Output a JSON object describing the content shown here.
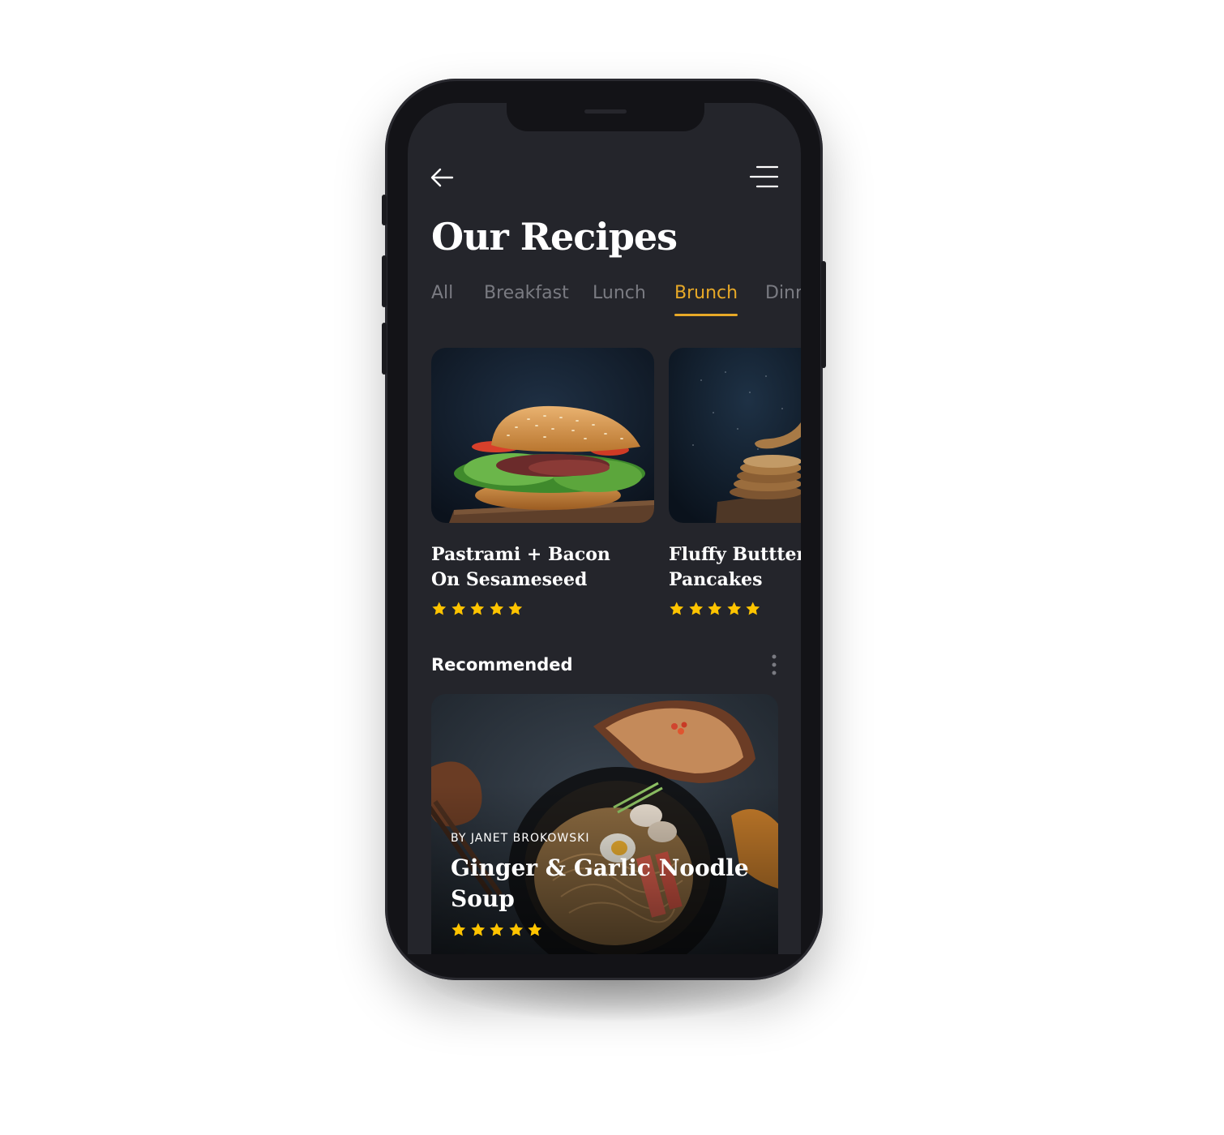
{
  "header": {
    "title": "Our Recipes"
  },
  "tabs": [
    {
      "label": "All"
    },
    {
      "label": "Breakfast"
    },
    {
      "label": "Lunch"
    },
    {
      "label": "Brunch",
      "active": true
    },
    {
      "label": "Dinr"
    }
  ],
  "cards": [
    {
      "title_line1": "Pastrami + Bacon",
      "title_line2": "On Sesameseed",
      "rating": 5,
      "image": "burger-photo"
    },
    {
      "title_line1": "Fluffy Butttern",
      "title_line2": "Pancakes",
      "rating": 5,
      "image": "pancakes-photo"
    }
  ],
  "recommended": {
    "section_title": "Recommended",
    "author": "BY JANET BROKOWSKI",
    "title": "Ginger & Garlic Noodle Soup",
    "rating": 5,
    "image": "noodle-soup-photo"
  },
  "colors": {
    "accent": "#e8a927",
    "star": "#ffc400",
    "background": "#24252b",
    "inactive_tab": "#7a7b82"
  }
}
